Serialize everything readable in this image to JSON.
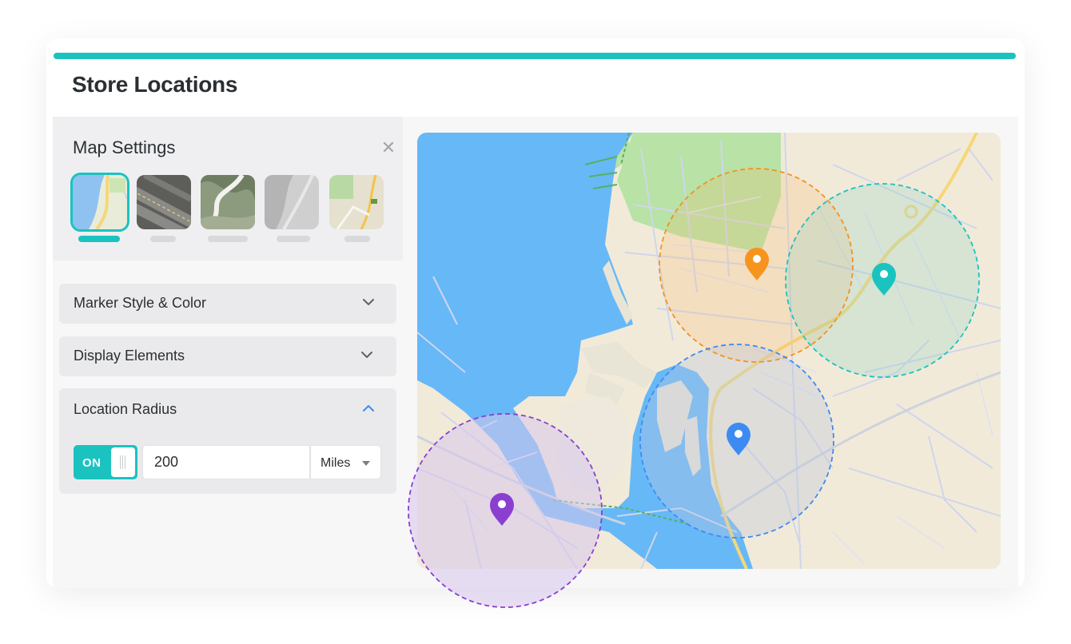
{
  "header": {
    "title": "Store Locations"
  },
  "settings": {
    "title": "Map Settings",
    "close_icon": "close-icon",
    "map_styles": [
      {
        "name": "light-map-style",
        "selected": true
      },
      {
        "name": "satellite-map-style",
        "selected": false
      },
      {
        "name": "terrain-map-style",
        "selected": false
      },
      {
        "name": "grayscale-map-style",
        "selected": false
      },
      {
        "name": "streets-map-style",
        "selected": false
      }
    ]
  },
  "accordions": {
    "marker_style": {
      "label": "Marker Style & Color",
      "icon": "chevron-down-icon"
    },
    "display_elements": {
      "label": "Display Elements",
      "icon": "chevron-down-icon"
    },
    "location_radius": {
      "label": "Location Radius",
      "icon": "chevron-up-icon"
    }
  },
  "radius": {
    "toggle_label": "ON",
    "value": "200",
    "unit": "Miles"
  },
  "colors": {
    "accent": "#1bc3c0",
    "marker_orange": "#f7941d",
    "marker_teal": "#1bc3c0",
    "marker_blue": "#3d8bf2",
    "marker_purple": "#8a3fd1",
    "water": "#67b8f7"
  }
}
